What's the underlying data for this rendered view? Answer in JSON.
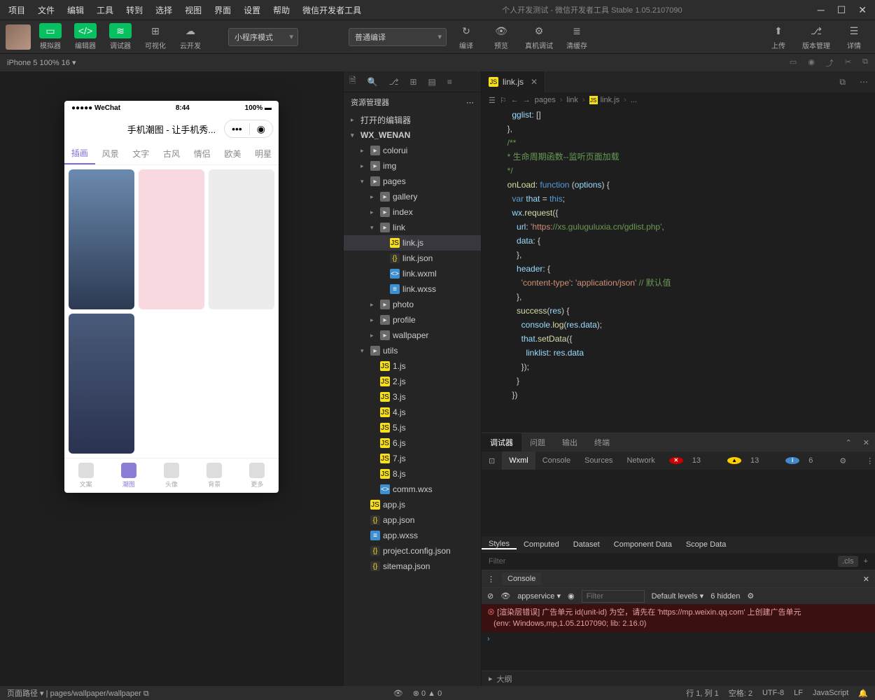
{
  "menubar": [
    "项目",
    "文件",
    "编辑",
    "工具",
    "转到",
    "选择",
    "视图",
    "界面",
    "设置",
    "帮助",
    "微信开发者工具"
  ],
  "window_title": "个人开发测试 - 微信开发者工具 Stable 1.05.2107090",
  "toolbar": {
    "simulator": "模拟器",
    "editor": "编辑器",
    "debugger": "调试器",
    "visual": "可视化",
    "cloud": "云开发",
    "mode": "小程序模式",
    "compile": "普通编译",
    "compile_btn": "编译",
    "preview": "预览",
    "realdebug": "真机调试",
    "clearcache": "清缓存",
    "upload": "上传",
    "version": "版本管理",
    "details": "详情"
  },
  "device": "iPhone 5 100% 16",
  "phone": {
    "carrier": "●●●●● WeChat",
    "time": "8:44",
    "battery": "100%",
    "title": "手机潮图 - 让手机秀...",
    "tabs": [
      "插画",
      "风景",
      "文字",
      "古风",
      "情侣",
      "欧美",
      "明星"
    ],
    "bottom": [
      "文案",
      "潮图",
      "头像",
      "背景",
      "更多"
    ]
  },
  "explorer": {
    "header": "资源管理器",
    "opened": "打开的编辑器",
    "project": "WX_WENAN",
    "tree": [
      {
        "d": 1,
        "t": "folder",
        "n": "colorui",
        "a": "▸"
      },
      {
        "d": 1,
        "t": "folder",
        "n": "img",
        "a": "▸"
      },
      {
        "d": 1,
        "t": "folder",
        "n": "pages",
        "a": "▾",
        "open": true
      },
      {
        "d": 2,
        "t": "folder",
        "n": "gallery",
        "a": "▸"
      },
      {
        "d": 2,
        "t": "folder",
        "n": "index",
        "a": "▸"
      },
      {
        "d": 2,
        "t": "folder",
        "n": "link",
        "a": "▾",
        "open": true
      },
      {
        "d": 3,
        "t": "js",
        "n": "link.js",
        "active": true
      },
      {
        "d": 3,
        "t": "json",
        "n": "link.json"
      },
      {
        "d": 3,
        "t": "wxml",
        "n": "link.wxml"
      },
      {
        "d": 3,
        "t": "wxss",
        "n": "link.wxss"
      },
      {
        "d": 2,
        "t": "folder",
        "n": "photo",
        "a": "▸"
      },
      {
        "d": 2,
        "t": "folder",
        "n": "profile",
        "a": "▸"
      },
      {
        "d": 2,
        "t": "folder",
        "n": "wallpaper",
        "a": "▸"
      },
      {
        "d": 1,
        "t": "folder",
        "n": "utils",
        "a": "▾",
        "open": true
      },
      {
        "d": 2,
        "t": "js",
        "n": "1.js"
      },
      {
        "d": 2,
        "t": "js",
        "n": "2.js"
      },
      {
        "d": 2,
        "t": "js",
        "n": "3.js"
      },
      {
        "d": 2,
        "t": "js",
        "n": "4.js"
      },
      {
        "d": 2,
        "t": "js",
        "n": "5.js"
      },
      {
        "d": 2,
        "t": "js",
        "n": "6.js"
      },
      {
        "d": 2,
        "t": "js",
        "n": "7.js"
      },
      {
        "d": 2,
        "t": "js",
        "n": "8.js"
      },
      {
        "d": 2,
        "t": "wxs",
        "n": "comm.wxs"
      },
      {
        "d": 1,
        "t": "js",
        "n": "app.js"
      },
      {
        "d": 1,
        "t": "json",
        "n": "app.json"
      },
      {
        "d": 1,
        "t": "wxss",
        "n": "app.wxss"
      },
      {
        "d": 1,
        "t": "json",
        "n": "project.config.json"
      },
      {
        "d": 1,
        "t": "json",
        "n": "sitemap.json"
      }
    ]
  },
  "editor": {
    "tab": "link.js",
    "breadcrumb": [
      "pages",
      "link",
      "link.js",
      "..."
    ],
    "code": [
      "    gglist: []",
      "  },",
      "",
      "  /**",
      "  * 生命周期函数--监听页面加载",
      "  */",
      "  onLoad: function (options) {",
      "    var that = this;",
      "    wx.request({",
      "      url: 'https://xs.guluguluxia.cn/gdlist.php',",
      "      data: {",
      "      },",
      "      header: {",
      "        'content-type': 'application/json' // 默认值",
      "      },",
      "      success(res) {",
      "        console.log(res.data);",
      "        that.setData({",
      "          linklist: res.data",
      "        });",
      "      }",
      "    })"
    ]
  },
  "debugger": {
    "tabs": [
      "调试器",
      "问题",
      "输出",
      "终端"
    ],
    "subtabs": [
      "Wxml",
      "Console",
      "Sources",
      "Network"
    ],
    "badges": {
      "err": "13",
      "warn": "13",
      "info": "6"
    },
    "styles_tabs": [
      "Styles",
      "Computed",
      "Dataset",
      "Component Data",
      "Scope Data"
    ],
    "filter_placeholder": "Filter",
    "cls": ".cls",
    "console_title": "Console",
    "console_context": "appservice",
    "console_filter": "Filter",
    "console_levels": "Default levels",
    "console_hidden": "6 hidden",
    "console_error": "[渲染层错误] 广告单元 id(unit-id) 为空，请先在 'https://mp.weixin.qq.com' 上创建广告单元",
    "console_env": "(env: Windows,mp,1.05.2107090; lib: 2.16.0)"
  },
  "outline": "大纲",
  "statusbar": {
    "path_label": "页面路径",
    "path_value": "pages/wallpaper/wallpaper",
    "warnings": "0",
    "errors": "0",
    "cursor": "行 1, 列 1",
    "spaces": "空格: 2",
    "encoding": "UTF-8",
    "eol": "LF",
    "lang": "JavaScript"
  }
}
